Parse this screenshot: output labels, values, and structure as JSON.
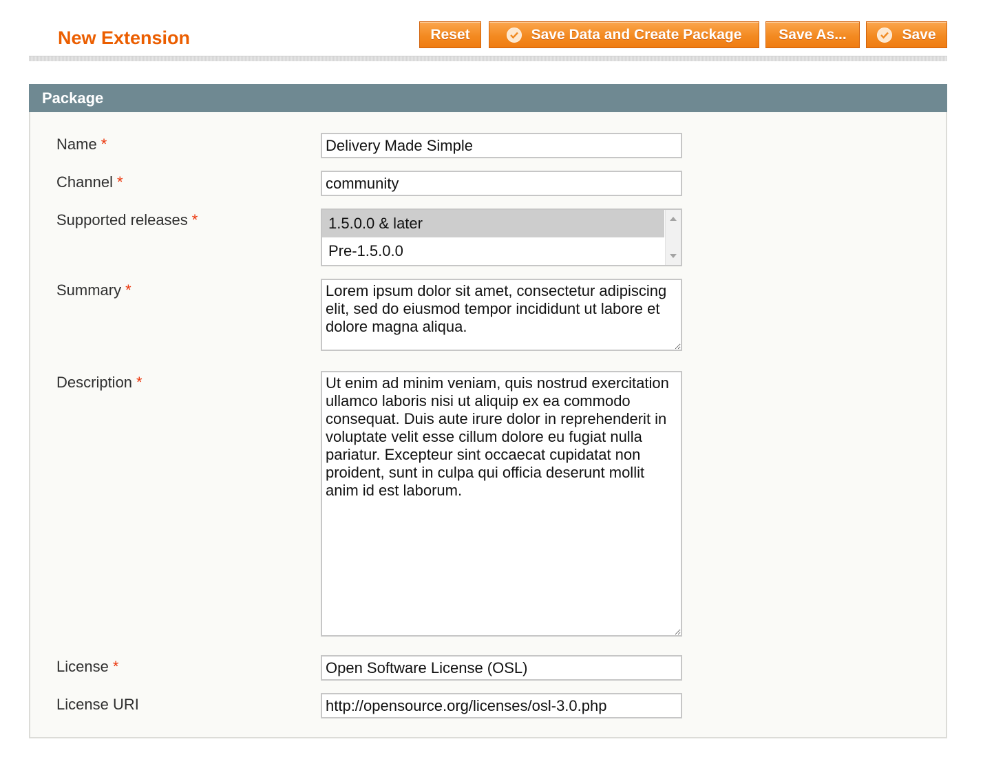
{
  "header": {
    "title": "New Extension",
    "buttons": {
      "reset": "Reset",
      "save_data_create_package": "Save Data and Create Package",
      "save_as": "Save As...",
      "save": "Save"
    }
  },
  "section": {
    "title": "Package",
    "required_marker": "*",
    "fields": {
      "name": {
        "label": "Name",
        "value": "Delivery Made Simple"
      },
      "channel": {
        "label": "Channel",
        "value": "community"
      },
      "supported_releases": {
        "label": "Supported releases",
        "options": [
          "1.5.0.0 & later",
          "Pre-1.5.0.0"
        ],
        "selected": "1.5.0.0 & later"
      },
      "summary": {
        "label": "Summary",
        "value": "Lorem ipsum dolor sit amet, consectetur adipiscing elit, sed do eiusmod tempor incididunt ut labore et dolore magna aliqua."
      },
      "description": {
        "label": "Description",
        "value": "Ut enim ad minim veniam, quis nostrud exercitation ullamco laboris nisi ut aliquip ex ea commodo consequat. Duis aute irure dolor in reprehenderit in voluptate velit esse cillum dolore eu fugiat nulla pariatur. Excepteur sint occaecat cupidatat non proident, sunt in culpa qui officia deserunt mollit anim id est laborum."
      },
      "license": {
        "label": "License",
        "value": "Open Software License (OSL)"
      },
      "license_uri": {
        "label": "License URI",
        "value": "http://opensource.org/licenses/osl-3.0.php"
      }
    }
  },
  "colors": {
    "accent_orange": "#eb5e00",
    "button_orange": "#f38a21",
    "section_header": "#6f8992",
    "required_star": "#eb340a"
  },
  "icons": {
    "button_check": "checkmark-circle-icon"
  }
}
